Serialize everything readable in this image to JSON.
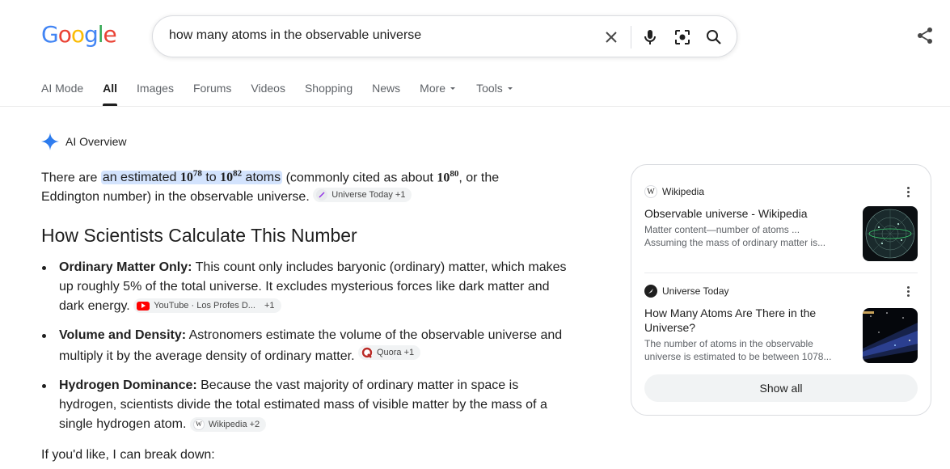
{
  "logo": {
    "letters": [
      "G",
      "o",
      "o",
      "g",
      "l",
      "e"
    ]
  },
  "search": {
    "query": "how many atoms in the observable universe"
  },
  "tabs": [
    {
      "label": "AI Mode"
    },
    {
      "label": "All"
    },
    {
      "label": "Images"
    },
    {
      "label": "Forums"
    },
    {
      "label": "Videos"
    },
    {
      "label": "Shopping"
    },
    {
      "label": "News"
    },
    {
      "label": "More"
    },
    {
      "label": "Tools"
    }
  ],
  "overview": {
    "title": "AI Overview",
    "intro": {
      "before": "There are ",
      "hl_a": "an estimated ",
      "n1": "10",
      "e1": "78",
      "to": " to ",
      "n2": "10",
      "e2": "82",
      "atoms": " atoms",
      "mid": " (commonly cited as about ",
      "n3": "10",
      "e3": "80",
      "after": ", or the Eddington number) in the observable universe.",
      "chip": "Universe Today +1"
    },
    "heading": "How Scientists Calculate This Number",
    "bullets": [
      {
        "bold": "Ordinary Matter Only:",
        "text": " This count only includes baryonic (ordinary) matter, which makes up roughly 5% of the total universe. It excludes mysterious forces like dark matter and dark energy.",
        "chip": "YouTube · Los Profes D...",
        "chip_extra": "+1"
      },
      {
        "bold": "Volume and Density:",
        "text": " Astronomers estimate the volume of the observable universe and multiply it by the average density of ordinary matter.",
        "chip": "Quora +1"
      },
      {
        "bold": "Hydrogen Dominance:",
        "text": " Because the vast majority of ordinary matter in space is hydrogen, scientists divide the total estimated mass of visible matter by the mass of a single hydrogen atom.",
        "chip": "Wikipedia +2"
      }
    ],
    "followup": "If you'd like, I can break down:"
  },
  "sources": [
    {
      "site": "Wikipedia",
      "title": "Observable universe - Wikipedia",
      "snippet": "Matter content—number of atoms ... Assuming the mass of ordinary matter is..."
    },
    {
      "site": "Universe Today",
      "title": "How Many Atoms Are There in the Universe?",
      "snippet": "The number of atoms in the observable universe is estimated to be between 1078..."
    }
  ],
  "show_all": "Show all",
  "colors": {
    "blue": "#4285F4",
    "red": "#EA4335",
    "yellow": "#FBBC05",
    "green": "#34A853",
    "highlight": "#d3e3fd"
  }
}
